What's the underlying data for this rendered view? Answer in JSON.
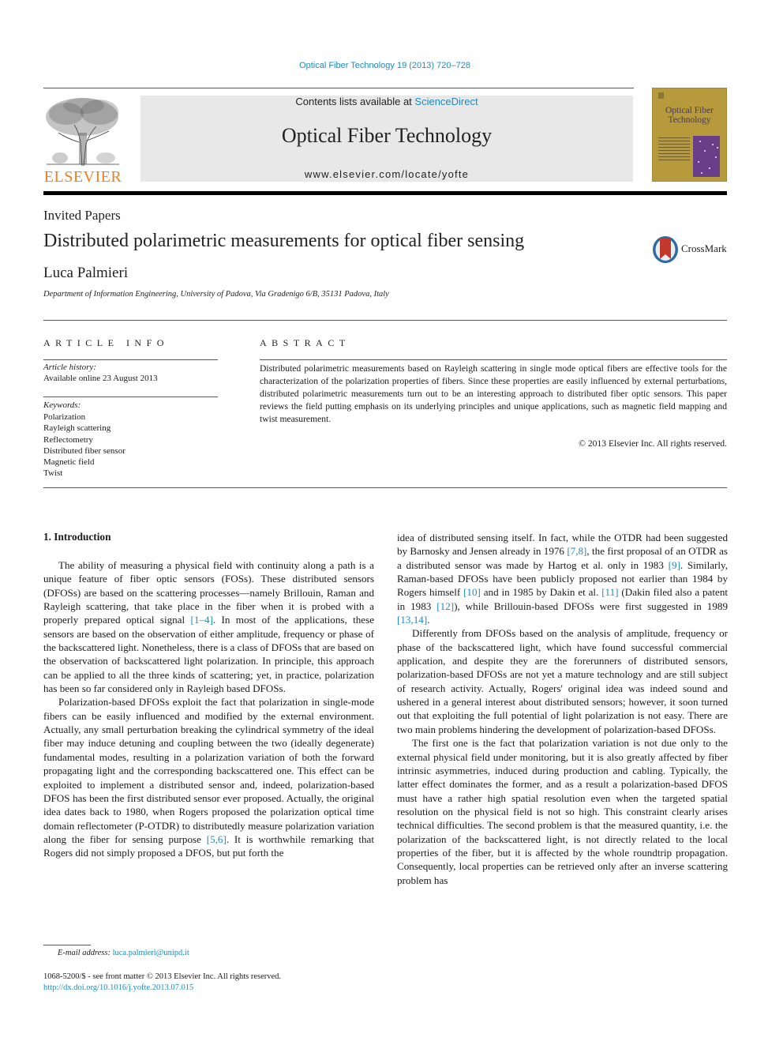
{
  "header": {
    "citation": "Optical Fiber Technology 19 (2013) 720–728",
    "publisher": "ELSEVIER",
    "contents_prefix": "Contents lists available at ",
    "contents_link": "ScienceDirect",
    "journal_title": "Optical Fiber Technology",
    "journal_url": "www.elsevier.com/locate/yofte",
    "cover_title_line1": "Optical Fiber",
    "cover_title_line2": "Technology",
    "colors": {
      "link": "#1f8ac0",
      "publisher_orange": "#f07d1e",
      "cover_gold": "#b69a3c",
      "cover_purple": "#6a3f8a"
    }
  },
  "article": {
    "section": "Invited Papers",
    "title": "Distributed polarimetric measurements for optical fiber sensing",
    "crossmark_label": "CrossMark",
    "author": "Luca Palmieri",
    "affiliation": "Department of Information Engineering, University of Padova, Via Gradenigo 6/B, 35131 Padova, Italy"
  },
  "article_info": {
    "heading": "ARTICLE INFO",
    "history_label": "Article history:",
    "history_value": "Available online 23 August 2013",
    "keywords_label": "Keywords:",
    "keywords": [
      "Polarization",
      "Rayleigh scattering",
      "Reflectometry",
      "Distributed fiber sensor",
      "Magnetic field",
      "Twist"
    ]
  },
  "abstract": {
    "heading": "ABSTRACT",
    "text": "Distributed polarimetric measurements based on Rayleigh scattering in single mode optical fibers are effective tools for the characterization of the polarization properties of fibers. Since these properties are easily influenced by external perturbations, distributed polarimetric measurements turn out to be an interesting approach to distributed fiber optic sensors. This paper reviews the field putting emphasis on its underlying principles and unique applications, such as magnetic field mapping and twist measurement.",
    "copyright": "© 2013 Elsevier Inc. All rights reserved."
  },
  "body": {
    "intro_heading": "1. Introduction",
    "p1": {
      "a": "The ability of measuring a physical field with continuity along a path is a unique feature of fiber optic sensors (FOSs). These distributed sensors (DFOSs) are based on the scattering processes—namely Brillouin, Raman and Rayleigh scattering, that take place in the fiber when it is probed with a properly prepared optical signal ",
      "ref1": "[1–4]",
      "b": ". In most of the applications, these sensors are based on the observation of either amplitude, frequency or phase of the backscattered light. Nonetheless, there is a class of DFOSs that are based on the observation of backscattered light polarization. In principle, this approach can be applied to all the three kinds of scattering; yet, in practice, polarization has been so far considered only in Rayleigh based DFOSs."
    },
    "p2": {
      "a": "Polarization-based DFOSs exploit the fact that polarization in single-mode fibers can be easily influenced and modified by the external environment. Actually, any small perturbation breaking the cylindrical symmetry of the ideal fiber may induce detuning and coupling between the two (ideally degenerate) fundamental modes, resulting in a polarization variation of both the forward propagating light and the corresponding backscattered one. This effect can be exploited to implement a distributed sensor and, indeed, polarization-based DFOS has been the first distributed sensor ever proposed. Actually, the original idea dates back to 1980, when Rogers proposed the polarization optical time domain reflectometer (P-OTDR) to distributedly measure polarization variation along the fiber for sensing purpose ",
      "ref1": "[5,6]",
      "b": ". It is worthwhile remarking that Rogers did not simply proposed a DFOS, but put forth the idea of distributed sensing itself. In fact, while the OTDR had been suggested by Barnosky and Jensen already in 1976 ",
      "ref2": "[7,8]",
      "c": ", the first proposal of an OTDR as a distributed sensor was made by Hartog et al. only in 1983 ",
      "ref3": "[9]",
      "d": ". Similarly, Raman-based DFOSs have been publicly proposed not earlier than 1984 by Rogers himself ",
      "ref4": "[10]",
      "e": " and in 1985 by Dakin et al. ",
      "ref5": "[11]",
      "f": " (Dakin filed also a patent in 1983 ",
      "ref6": "[12]",
      "g": "), while Brillouin-based DFOSs were first suggested in 1989 ",
      "ref7": "[13,14]",
      "h": "."
    },
    "p3": "Differently from DFOSs based on the analysis of amplitude, frequency or phase of the backscattered light, which have found successful commercial application, and despite they are the forerunners of distributed sensors, polarization-based DFOSs are not yet a mature technology and are still subject of research activity. Actually, Rogers' original idea was indeed sound and ushered in a general interest about distributed sensors; however, it soon turned out that exploiting the full potential of light polarization is not easy. There are two main problems hindering the development of polarization-based DFOSs.",
    "p4": "The first one is the fact that polarization variation is not due only to the external physical field under monitoring, but it is also greatly affected by fiber intrinsic asymmetries, induced during production and cabling. Typically, the latter effect dominates the former, and as a result a polarization-based DFOS must have a rather high spatial resolution even when the targeted spatial resolution on the physical field is not so high. This constraint clearly arises technical difficulties. The second problem is that the measured quantity, i.e. the polarization of the backscattered light, is not directly related to the local properties of the fiber, but it is affected by the whole roundtrip propagation. Consequently, local properties can be retrieved only after an inverse scattering problem has"
  },
  "footer": {
    "email_label": "E-mail address:",
    "email": "luca.palmieri@unipd.it",
    "issn_line": "1068-5200/$ - see front matter © 2013 Elsevier Inc. All rights reserved.",
    "doi": "http://dx.doi.org/10.1016/j.yofte.2013.07.015"
  }
}
